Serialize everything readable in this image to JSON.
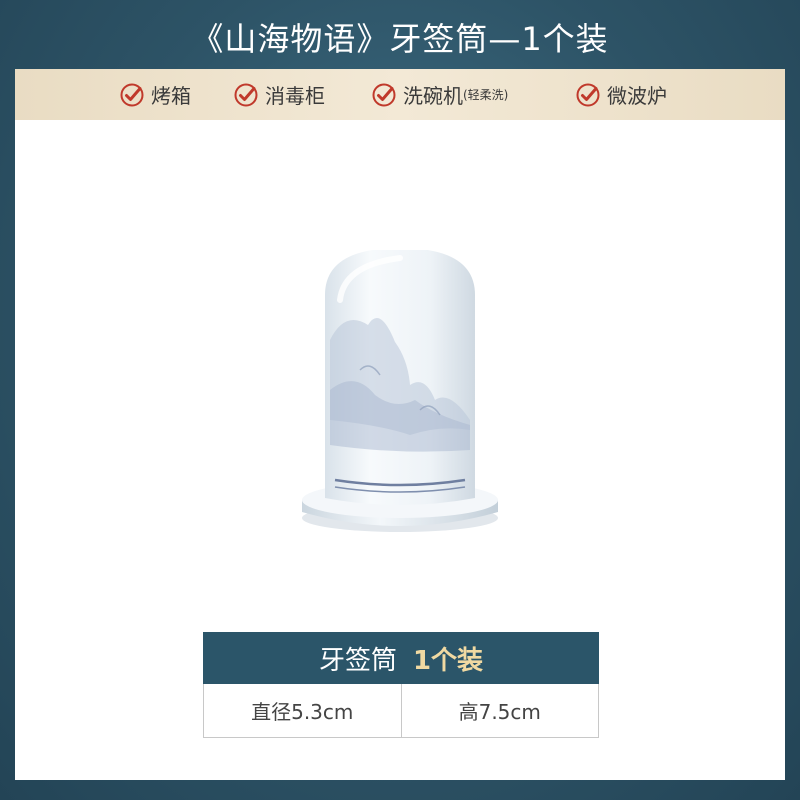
{
  "title": "《山海物语》牙签筒—1个装",
  "features": [
    {
      "label": "烤箱",
      "sub": ""
    },
    {
      "label": "消毒柜",
      "sub": ""
    },
    {
      "label": "洗碗机",
      "sub": "(轻柔洗)"
    },
    {
      "label": "微波炉",
      "sub": ""
    }
  ],
  "spec": {
    "name": "牙签筒",
    "qty": "1个装",
    "diameter": "直径5.3cm",
    "height": "高7.5cm"
  },
  "colors": {
    "background": "#2d5366",
    "feature_bar": "#f3e9d6",
    "check": "#c0392b",
    "spec_header": "#2b5569",
    "qty_accent": "#f0d9a2"
  }
}
